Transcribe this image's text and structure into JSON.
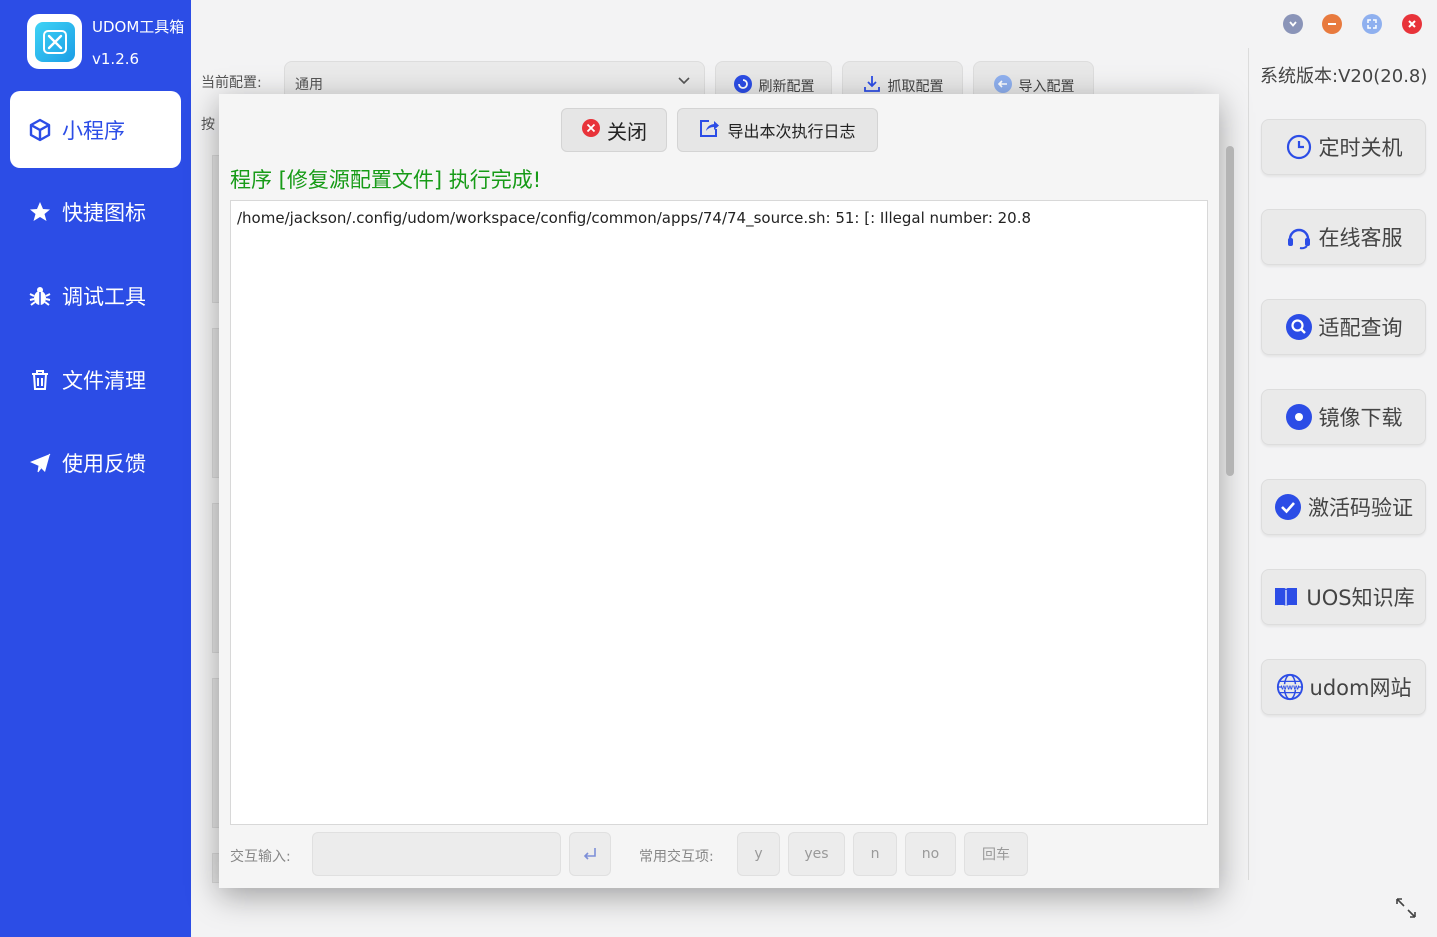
{
  "app": {
    "name": "UDOM工具箱",
    "version": "v1.2.6"
  },
  "sidebar": {
    "items": [
      {
        "label": "小程序",
        "icon": "cube-icon"
      },
      {
        "label": "快捷图标",
        "icon": "star-icon"
      },
      {
        "label": "调试工具",
        "icon": "bug-icon"
      },
      {
        "label": "文件清理",
        "icon": "trash-icon"
      },
      {
        "label": "使用反馈",
        "icon": "paper-plane-icon"
      }
    ]
  },
  "window_controls": {
    "colors": {
      "menu": "#8a94b8",
      "minimize": "#e87a3e",
      "maximize": "#8fb0ef",
      "close": "#e8333a"
    }
  },
  "config": {
    "label": "当前配置:",
    "selected": "通用",
    "buttons": {
      "refresh": "刷新配置",
      "fetch": "抓取配置",
      "import": "导入配置"
    },
    "partial_label": "按"
  },
  "right_panel": {
    "system_version": "系统版本:V20(20.8)",
    "buttons": [
      {
        "label": "定时关机",
        "icon": "clock-icon"
      },
      {
        "label": "在线客服",
        "icon": "headset-icon"
      },
      {
        "label": "适配查询",
        "icon": "search-icon"
      },
      {
        "label": "镜像下载",
        "icon": "disc-icon"
      },
      {
        "label": "激活码验证",
        "icon": "check-circle-icon"
      },
      {
        "label": "UOS知识库",
        "icon": "book-icon"
      },
      {
        "label": "udom网站",
        "icon": "globe-icon"
      }
    ]
  },
  "modal": {
    "close_label": "关闭",
    "export_label": "导出本次执行日志",
    "title": "程序 [修复源配置文件] 执行完成!",
    "log": "/home/jackson/.config/udom/workspace/config/common/apps/74/74_source.sh: 51: [: Illegal number: 20.8",
    "interactive": {
      "label": "交互输入:",
      "value": "",
      "common_label": "常用交互项:",
      "options": [
        "y",
        "yes",
        "n",
        "no",
        "回车"
      ]
    }
  },
  "colors": {
    "brand": "#2c4de6",
    "success_text": "#179b17",
    "accent_icon": "#2c4de6"
  }
}
